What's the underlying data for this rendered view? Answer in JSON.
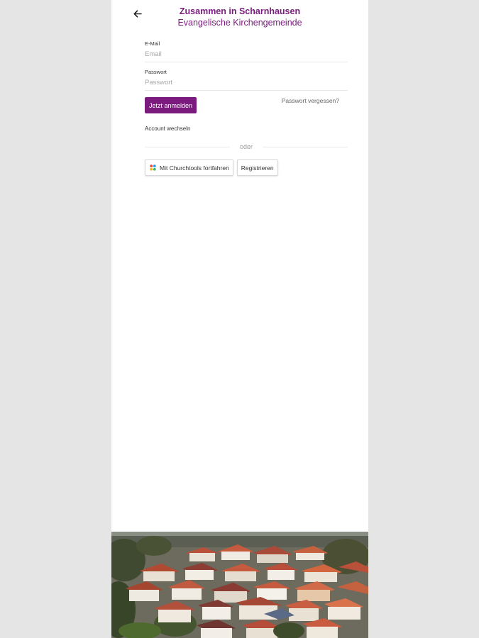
{
  "header": {
    "title": "Zusammen in Scharnhausen",
    "subtitle": "Evangelische Kirchengemeinde"
  },
  "back_icon": "arrow-left-icon",
  "email": {
    "label": "E-Mail",
    "placeholder": "Email",
    "value": ""
  },
  "password": {
    "label": "Passwort",
    "placeholder": "Passwort",
    "value": ""
  },
  "login_button": "Jetzt anmelden",
  "forgot_password": "Passwort vergessen?",
  "switch_account": "Account wechseln",
  "divider_text": "oder",
  "churchtools_button": "Mit Churchtools fortfahren",
  "churchtools_icon": "churchtools-logo-icon",
  "register_button": "Registrieren",
  "colors": {
    "brand": "#7b1b7e",
    "background": "#e5e5e5",
    "card": "#ffffff"
  }
}
